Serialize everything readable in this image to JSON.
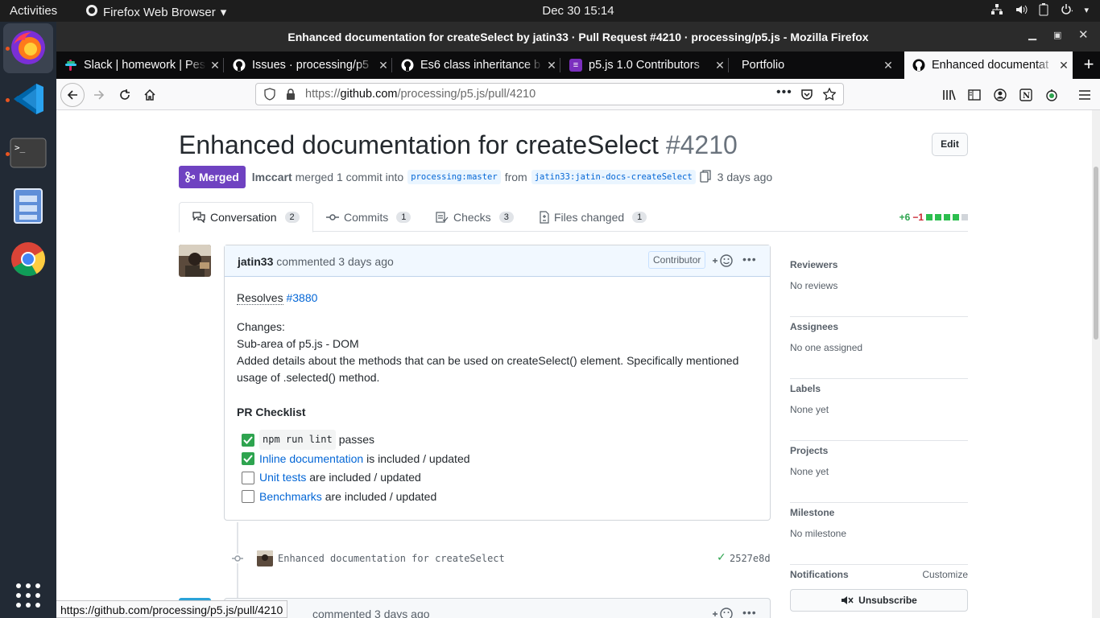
{
  "system": {
    "activities": "Activities",
    "app_name": "Firefox Web Browser",
    "clock": "Dec 30  15:14"
  },
  "window": {
    "title": "Enhanced documentation for createSelect by jatin33 · Pull Request #4210 · processing/p5.js - Mozilla Firefox"
  },
  "tabs": [
    {
      "label": "Slack | homework | Pes"
    },
    {
      "label": "Issues · processing/p5"
    },
    {
      "label": "Es6 class inheritance b"
    },
    {
      "label": "p5.js 1.0 Contributors"
    },
    {
      "label": "Portfolio"
    },
    {
      "label": "Enhanced documentat"
    }
  ],
  "urlbar": {
    "prefix": "https://",
    "domain": "github.com",
    "path": "/processing/p5.js/pull/4210"
  },
  "pr": {
    "title": "Enhanced documentation for createSelect",
    "number": "#4210",
    "edit_label": "Edit",
    "state": "Merged",
    "merger": "lmccart",
    "merged_text": "merged 1 commit into",
    "base_branch": "processing:master",
    "from_text": "from",
    "head_branch": "jatin33:jatin-docs-createSelect",
    "time": "3 days ago"
  },
  "tabnav": {
    "conversation": {
      "label": "Conversation",
      "count": "2"
    },
    "commits": {
      "label": "Commits",
      "count": "1"
    },
    "checks": {
      "label": "Checks",
      "count": "3"
    },
    "files": {
      "label": "Files changed",
      "count": "1"
    },
    "additions": "+6",
    "deletions": "−1"
  },
  "comment": {
    "author": "jatin33",
    "action": "commented 3 days ago",
    "role": "Contributor",
    "resolves_label": "Resolves",
    "resolves_issue": "#3880",
    "changes_heading": "Changes:",
    "subarea": "Sub-area of p5.js - DOM",
    "details": "Added details about the methods that can be used on createSelect() element. Specifically mentioned usage of .selected() method.",
    "checklist_heading": "PR Checklist",
    "checklist": [
      {
        "code": "npm run lint",
        "link": "",
        "text": "passes",
        "checked": true
      },
      {
        "code": "",
        "link": "Inline documentation",
        "text": "is included / updated",
        "checked": true
      },
      {
        "code": "",
        "link": "Unit tests",
        "text": "are included / updated",
        "checked": false
      },
      {
        "code": "",
        "link": "Benchmarks",
        "text": "are included / updated",
        "checked": false
      }
    ]
  },
  "commit": {
    "message": "Enhanced documentation for createSelect",
    "sha": "2527e8d"
  },
  "next_comment": {
    "action": "commented 3 days ago"
  },
  "sidebar": {
    "reviewers": {
      "heading": "Reviewers",
      "value": "No reviews"
    },
    "assignees": {
      "heading": "Assignees",
      "value": "No one assigned"
    },
    "labels": {
      "heading": "Labels",
      "value": "None yet"
    },
    "projects": {
      "heading": "Projects",
      "value": "None yet"
    },
    "milestone": {
      "heading": "Milestone",
      "value": "No milestone"
    },
    "notifications": {
      "heading": "Notifications",
      "customize": "Customize",
      "button": "Unsubscribe"
    }
  },
  "status_url": "https://github.com/processing/p5.js/pull/4210",
  "colors": {
    "merged": "#6f42c1",
    "link": "#0366d6",
    "success": "#2ea44f",
    "danger": "#cb2431"
  }
}
